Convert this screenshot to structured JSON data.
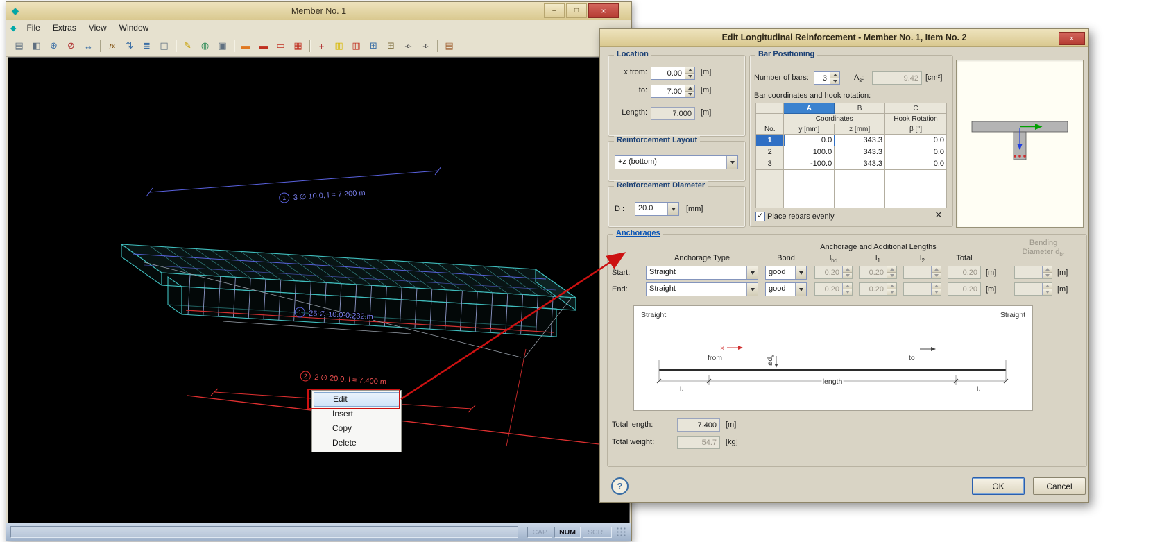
{
  "colors": {
    "accent_blue": "#316ac5",
    "annotation_red": "#cc1111",
    "titlebar_tan": "#ddd0a0",
    "dialog_bg": "#d9d4c5",
    "viewport_teal": "#3fbdbd"
  },
  "icons": {
    "app": "◆",
    "minimize": "–",
    "maximize": "□",
    "close": "×",
    "dropdown_arrow": "▼",
    "checkbox_check": "✓",
    "delete_rebar": "✕",
    "marker_x": "×",
    "help": "?"
  },
  "main_window": {
    "title": "Member No. 1",
    "menus": [
      "File",
      "Extras",
      "View",
      "Window"
    ],
    "toolbar": {
      "icons": [
        {
          "name": "print",
          "glyph": "▤",
          "color": "#607080"
        },
        {
          "name": "render",
          "glyph": "◧",
          "color": "#607080"
        },
        {
          "name": "zoom-in",
          "glyph": "⊕",
          "color": "#3a6ea5"
        },
        {
          "name": "zoom-cancel",
          "glyph": "⊘",
          "color": "#b03030"
        },
        {
          "name": "pan",
          "glyph": "↔",
          "color": "#3a6ea5"
        },
        {
          "sep": true
        },
        {
          "name": "function",
          "glyph": "ƒx",
          "color": "#805010",
          "small": true
        },
        {
          "name": "sort-items",
          "glyph": "⇅",
          "color": "#3a6ea5"
        },
        {
          "name": "list-items",
          "glyph": "≣",
          "color": "#3a6ea5"
        },
        {
          "name": "panels",
          "glyph": "◫",
          "color": "#607080"
        },
        {
          "sep": true
        },
        {
          "name": "edit-pencil",
          "glyph": "✎",
          "color": "#c8a000"
        },
        {
          "name": "globe",
          "glyph": "◍",
          "color": "#2e8b57"
        },
        {
          "name": "snapshot",
          "glyph": "▣",
          "color": "#607080"
        },
        {
          "sep": true
        },
        {
          "name": "result-solid-orange",
          "glyph": "▬",
          "color": "#e07820"
        },
        {
          "name": "result-solid-red",
          "glyph": "▬",
          "color": "#c03020"
        },
        {
          "name": "result-frame",
          "glyph": "▭",
          "color": "#c03020"
        },
        {
          "name": "result-hatch",
          "glyph": "▦",
          "color": "#c03020"
        },
        {
          "sep": true
        },
        {
          "name": "axes",
          "glyph": "+",
          "color": "#b03030"
        },
        {
          "name": "diagram-yellow",
          "glyph": "▥",
          "color": "#d8b800"
        },
        {
          "name": "diagram-red",
          "glyph": "▥",
          "color": "#c03020"
        },
        {
          "name": "table-grid",
          "glyph": "⊞",
          "color": "#3a6ea5"
        },
        {
          "name": "table-grid-2",
          "glyph": "⊞",
          "color": "#807040"
        },
        {
          "name": "compression",
          "glyph": "-c-",
          "color": "#505050",
          "small": true
        },
        {
          "name": "tension",
          "glyph": "-t-",
          "color": "#505050",
          "small": true
        },
        {
          "sep": true
        },
        {
          "name": "print-color",
          "glyph": "▤",
          "color": "#a06030"
        }
      ]
    },
    "viewport_labels": {
      "top_bars": {
        "index": "1",
        "text": "3 ∅ 10.0, l = 7.200 m"
      },
      "stirrups": {
        "index": "1",
        "text": "25 ∅ 10.0·0.232 m"
      },
      "bottom_bars": {
        "index": "2",
        "text": "2 ∅ 20.0, l = 7.400 m"
      }
    },
    "context_menu": {
      "items": [
        "Edit",
        "Insert",
        "Copy",
        "Delete"
      ]
    },
    "statusbar": {
      "cap": "CAP",
      "num": "NUM",
      "scrl": "SCRL"
    }
  },
  "dialog": {
    "title": "Edit Longitudinal Reinforcement - Member No. 1, Item No. 2",
    "location": {
      "title": "Location",
      "x_from_label": "x from:",
      "x_from_value": "0.00",
      "to_label": "to:",
      "to_value": "7.00",
      "length_label": "Length:",
      "length_value": "7.000",
      "unit": "[m]"
    },
    "layout": {
      "title": "Reinforcement Layout",
      "value": "+z (bottom)"
    },
    "diameter": {
      "title": "Reinforcement Diameter",
      "label": "D :",
      "value": "20.0",
      "unit": "[mm]"
    },
    "bar_positioning": {
      "title": "Bar Positioning",
      "number_label": "Number of bars:",
      "number_value": "3",
      "area_label_base": "A",
      "area_label_sub": "s",
      "area_label_colon": ":",
      "area_value": "9.42",
      "area_unit": "[cm²]",
      "coords_label": "Bar coordinates and hook rotation:",
      "table": {
        "letters": [
          "A",
          "B",
          "C"
        ],
        "coordinates_header": "Coordinates",
        "hook_header": "Hook Rotation",
        "no_header": "No.",
        "y_header": "y [mm]",
        "z_header": "z [mm]",
        "beta_header": "β [°]",
        "rows": [
          [
            "1",
            "0.0",
            "343.3",
            "0.0"
          ],
          [
            "2",
            "100.0",
            "343.3",
            "0.0"
          ],
          [
            "3",
            "-100.0",
            "343.3",
            "0.0"
          ]
        ]
      },
      "place_evenly_label": "Place rebars evenly"
    },
    "anchorages": {
      "title": "Anchorages",
      "header_type": "Anchorage Type",
      "header_bond": "Bond",
      "header_lengths": "Anchorage and Additional Lengths",
      "header_lbd_base": "l",
      "header_lbd_sub": "bd",
      "header_l1_base": "l",
      "header_l1_sub": "1",
      "header_l2_base": "l",
      "header_l2_sub": "2",
      "header_total": "Total",
      "header_bending_1": "Bending",
      "header_bending_2_base": "Diameter d",
      "header_bending_2_sub": "br",
      "rows": [
        {
          "label": "Start:",
          "type": "Straight",
          "bond": "good",
          "lbd": "0.20",
          "l1": "0.20",
          "l2": "",
          "total": "0.20",
          "unit": "[m]",
          "bending": "",
          "bending_unit": "[m]"
        },
        {
          "label": "End:",
          "type": "Straight",
          "bond": "good",
          "lbd": "0.20",
          "l1": "0.20",
          "l2": "",
          "total": "0.20",
          "unit": "[m]",
          "bending": "",
          "bending_unit": "[m]"
        }
      ],
      "diagram": {
        "left_type": "Straight",
        "right_type": "Straight",
        "from_label": "from",
        "to_label": "to",
        "bar_dia_base": "ød",
        "bar_dia_sub": "s",
        "length_label": "length",
        "l1_base": "l",
        "l1_sub": "1"
      },
      "total_length_label": "Total length:",
      "total_length_value": "7.400",
      "total_weight_label": "Total weight:",
      "total_weight_value": "54.7",
      "unit_m": "[m]",
      "unit_kg": "[kg]"
    },
    "buttons": {
      "ok": "OK",
      "cancel": "Cancel"
    }
  }
}
